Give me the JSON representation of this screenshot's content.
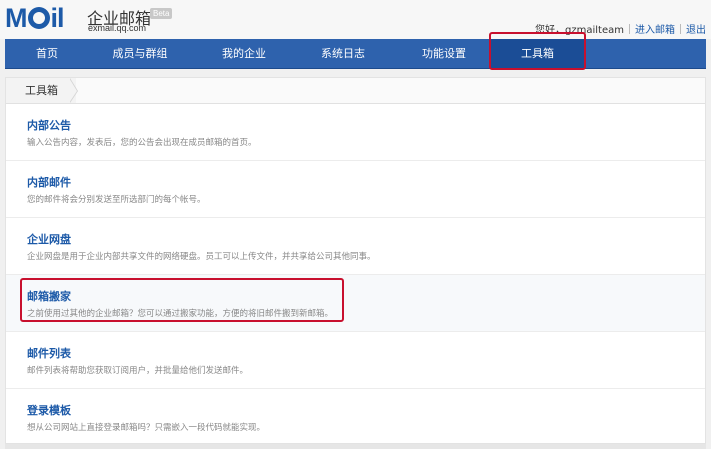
{
  "header": {
    "logo_text": "MOil",
    "logo_cn": "企业邮箱",
    "beta": "Beta",
    "domain": "exmail.qq.com",
    "greeting": "您好，gzmailteam",
    "enter_mail": "进入邮箱",
    "logout": "退出"
  },
  "nav": {
    "items": [
      {
        "label": "首页"
      },
      {
        "label": "成员与群组"
      },
      {
        "label": "我的企业"
      },
      {
        "label": "系统日志"
      },
      {
        "label": "功能设置"
      },
      {
        "label": "工具箱"
      }
    ],
    "active_index": 5
  },
  "breadcrumb": {
    "label": "工具箱"
  },
  "tools": [
    {
      "title": "内部公告",
      "desc": "输入公告内容，发表后，您的公告会出现在成员邮箱的首页。"
    },
    {
      "title": "内部邮件",
      "desc": "您的邮件将会分别发送至所选部门的每个帐号。"
    },
    {
      "title": "企业网盘",
      "desc": "企业网盘是用于企业内部共享文件的网络硬盘。员工可以上传文件，并共享给公司其他同事。"
    },
    {
      "title": "邮箱搬家",
      "desc": "之前使用过其他的企业邮箱？您可以通过搬家功能，方便的将旧邮件搬到新邮箱。"
    },
    {
      "title": "邮件列表",
      "desc": "邮件列表将帮助您获取订阅用户，并批量给他们发送邮件。"
    },
    {
      "title": "登录模板",
      "desc": "想从公司网站上直接登录邮箱吗？只需嵌入一段代码就能实现。"
    }
  ],
  "colors": {
    "nav_bg": "#2e62ad",
    "nav_active": "#1b4d96",
    "link": "#1d5aa8",
    "highlight": "#c8102e"
  }
}
